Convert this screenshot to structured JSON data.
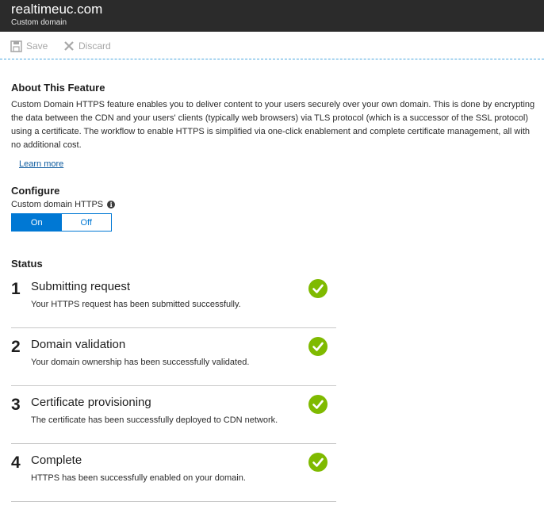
{
  "header": {
    "title": "realtimeuc.com",
    "subtitle": "Custom domain"
  },
  "toolbar": {
    "save_label": "Save",
    "discard_label": "Discard"
  },
  "about": {
    "heading": "About This Feature",
    "body": "Custom Domain HTTPS feature enables you to deliver content to your users securely over your own domain. This is done by encrypting the data between the CDN and your users' clients (typically web browsers) via TLS protocol (which is a successor of the SSL protocol) using a certificate. The workflow to enable HTTPS is simplified via one-click enablement and complete certificate management, all with no additional cost.",
    "learn_more": "Learn more"
  },
  "configure": {
    "heading": "Configure",
    "field_label": "Custom domain HTTPS",
    "on_label": "On",
    "off_label": "Off",
    "selected": "On"
  },
  "status": {
    "heading": "Status",
    "steps": [
      {
        "num": "1",
        "title": "Submitting request",
        "desc": "Your HTTPS request has been submitted successfully."
      },
      {
        "num": "2",
        "title": "Domain validation",
        "desc": "Your domain ownership has been successfully validated."
      },
      {
        "num": "3",
        "title": "Certificate provisioning",
        "desc": "The certificate has been successfully deployed to CDN network."
      },
      {
        "num": "4",
        "title": "Complete",
        "desc": "HTTPS has been successfully enabled on your domain."
      }
    ]
  },
  "colors": {
    "accent": "#0078d4",
    "success": "#7fba00",
    "titlebar": "#2b2b2b"
  },
  "icons": {
    "save": "save-icon",
    "discard": "close-icon",
    "info": "info-icon",
    "check": "check-circle-icon"
  }
}
